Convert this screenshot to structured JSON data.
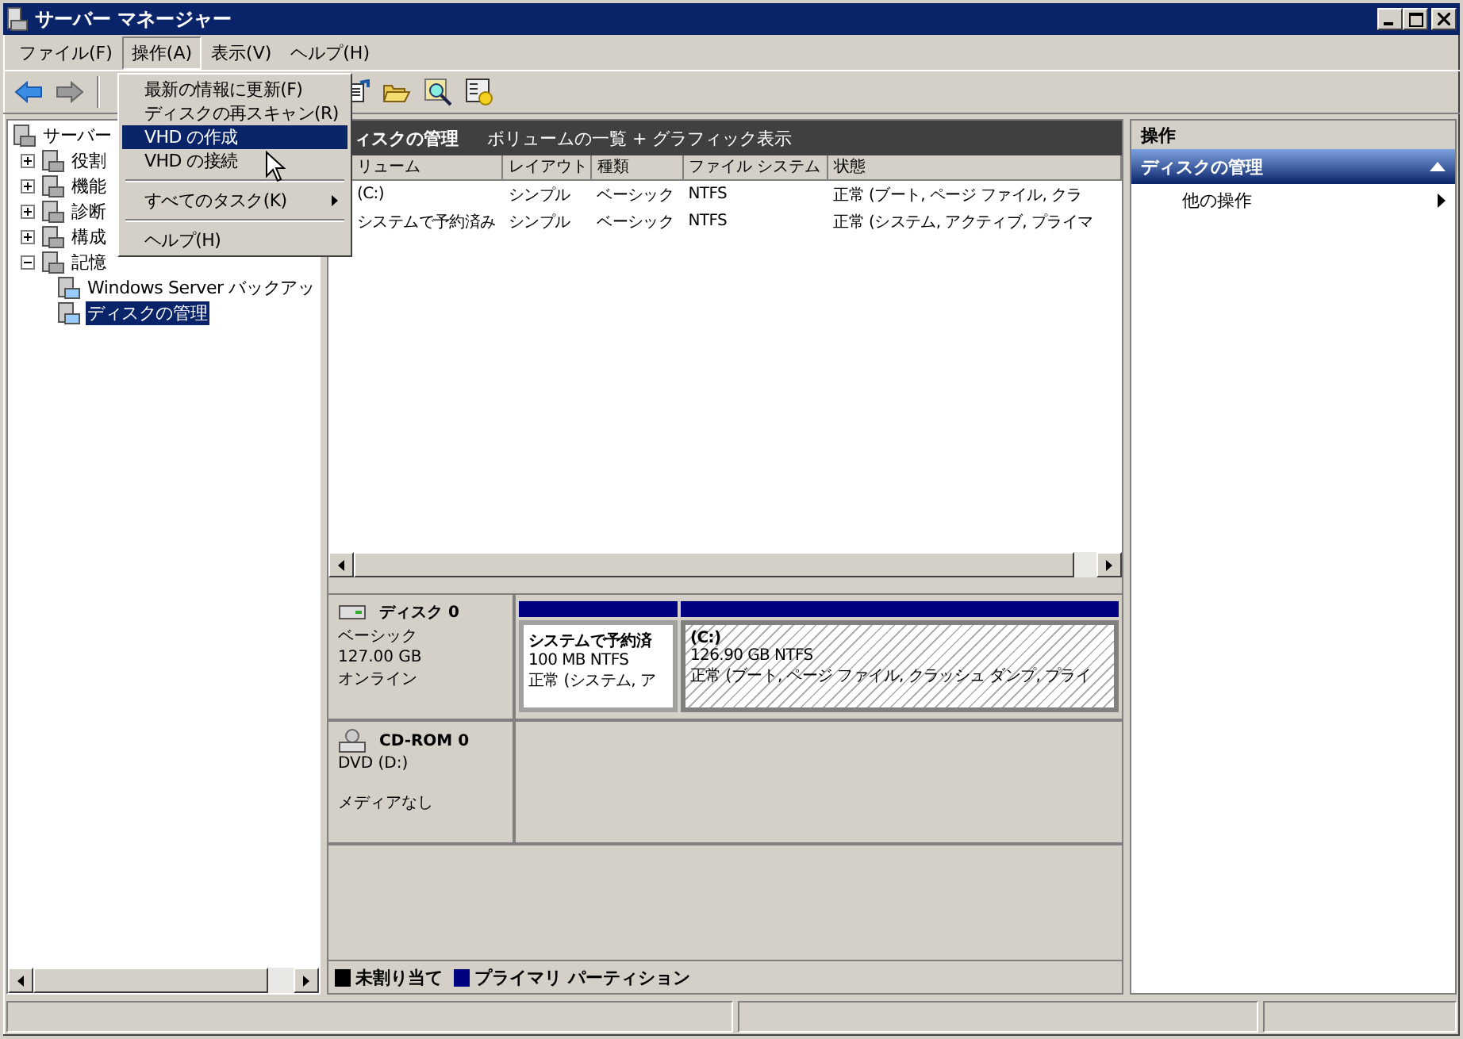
{
  "window": {
    "title": "サーバー マネージャー"
  },
  "menubar": [
    {
      "label": "ファイル(F)",
      "selected": false
    },
    {
      "label": "操作(A)",
      "selected": true
    },
    {
      "label": "表示(V)",
      "selected": false
    },
    {
      "label": "ヘルプ(H)",
      "selected": false
    }
  ],
  "menu": [
    {
      "kind": "item",
      "label": "最新の情報に更新(F)",
      "selected": false
    },
    {
      "kind": "item",
      "label": "ディスクの再スキャン(R)",
      "selected": false
    },
    {
      "kind": "item",
      "label": "VHD の作成",
      "selected": true
    },
    {
      "kind": "item",
      "label": "VHD の接続",
      "selected": false
    },
    {
      "kind": "separator"
    },
    {
      "kind": "submenu",
      "label": "すべてのタスク(K)",
      "selected": false
    },
    {
      "kind": "separator"
    },
    {
      "kind": "item",
      "label": "ヘルプ(H)",
      "selected": false
    }
  ],
  "tree": [
    {
      "label": "サーバー",
      "selected": false,
      "children": [
        {
          "label": "役割",
          "expanded": false,
          "selected": false
        },
        {
          "label": "機能",
          "expanded": false,
          "selected": false
        },
        {
          "label": "診断",
          "expanded": false,
          "selected": false
        },
        {
          "label": "構成",
          "expanded": false,
          "selected": false
        },
        {
          "label": "記憶",
          "expanded": true,
          "selected": false,
          "children": [
            {
              "label": "Windows Server バックアッ",
              "selected": false
            },
            {
              "label": "ディスクの管理",
              "selected": true
            }
          ]
        }
      ]
    }
  ],
  "center": {
    "title": "ィスクの管理",
    "subtitle": "ボリュームの一覧 + グラフィック表示",
    "table": {
      "columns": [
        "リューム",
        "レイアウト",
        "種類",
        "ファイル システム",
        "状態"
      ],
      "rows": [
        [
          "(C:)",
          "シンプル",
          "ベーシック",
          "NTFS",
          "正常 (ブート, ページ ファイル, クラ"
        ],
        [
          "システムで予約済み",
          "シンプル",
          "ベーシック",
          "NTFS",
          "正常 (システム, アクティブ, プライマ"
        ]
      ]
    },
    "disks": [
      {
        "kind": "disk",
        "name": "ディスク 0",
        "type": "ベーシック",
        "size": "127.00 GB",
        "status": "オンライン",
        "partitions": [
          {
            "name": "システムで予約済",
            "size": "100 MB NTFS",
            "status": "正常 (システム, ア",
            "selected": false
          },
          {
            "name": "(C:)",
            "size": "126.90 GB NTFS",
            "status": "正常 (ブート, ページ ファイル, クラッシュ ダンプ, プライ",
            "selected": true
          }
        ]
      },
      {
        "kind": "cdrom",
        "name": "CD-ROM 0",
        "type": "DVD (D:)",
        "status": "メディアなし"
      }
    ],
    "legend": [
      {
        "label": "未割り当て",
        "color": "#000000"
      },
      {
        "label": "プライマリ パーティション",
        "color": "#000080"
      }
    ]
  },
  "actions": {
    "title": "操作",
    "section": {
      "label": "ディスクの管理",
      "expanded": true
    },
    "items": [
      "他の操作"
    ]
  }
}
